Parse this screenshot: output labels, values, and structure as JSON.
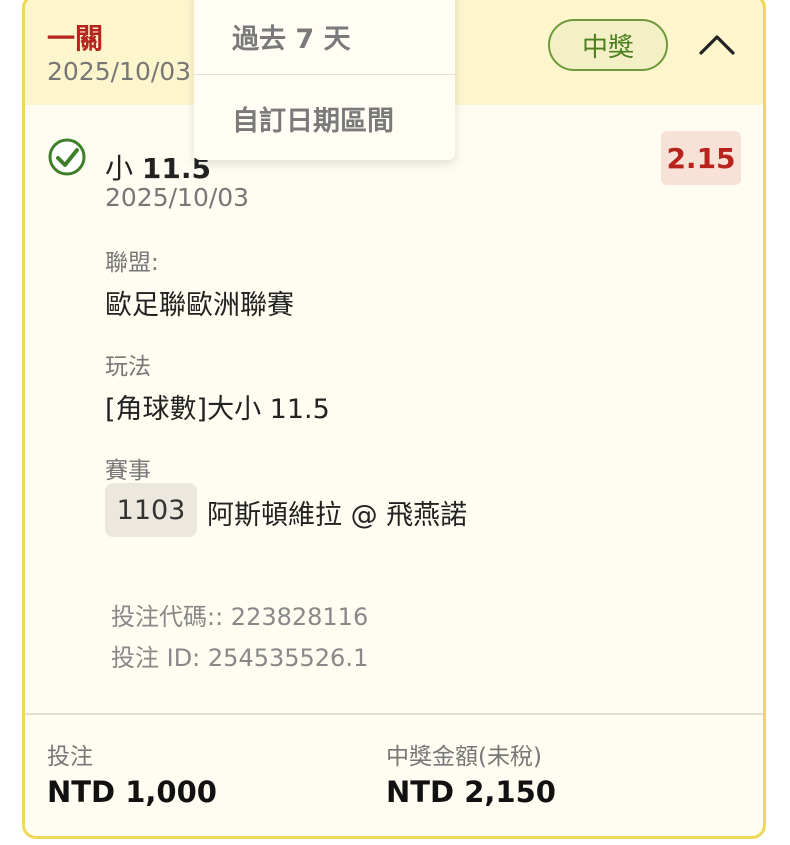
{
  "bet": {
    "type_label": "一關",
    "date": "2025/10/03",
    "status": "中獎",
    "selection_prefix": "小",
    "selection_value": "11.5",
    "selection_date": "2025/10/03",
    "odds": "2.15"
  },
  "details": {
    "league_label": "聯盟:",
    "league_value": "歐足聯歐洲聯賽",
    "market_label": "玩法",
    "market_value": "[角球數]大小 11.5",
    "event_label": "賽事",
    "event_code": "1103",
    "event_name": "阿斯頓維拉 @ 飛燕諾"
  },
  "meta": {
    "bet_code": "投注代碼:: 223828116",
    "bet_id": "投注 ID: 254535526.1"
  },
  "footer": {
    "stake_label": "投注",
    "stake_value": "NTD 1,000",
    "payout_label": "中獎金額(未稅)",
    "payout_value": "NTD 2,150"
  },
  "dropdown": {
    "items": [
      "過去 7 天",
      "自訂日期區間"
    ]
  },
  "colors": {
    "accent_red": "#b8231e",
    "win_green": "#4c7f1d",
    "card_border": "#f0d857",
    "header_bg": "#fdf5cc"
  },
  "icons": {
    "check": "check-circle-icon",
    "collapse": "chevron-up-icon"
  }
}
